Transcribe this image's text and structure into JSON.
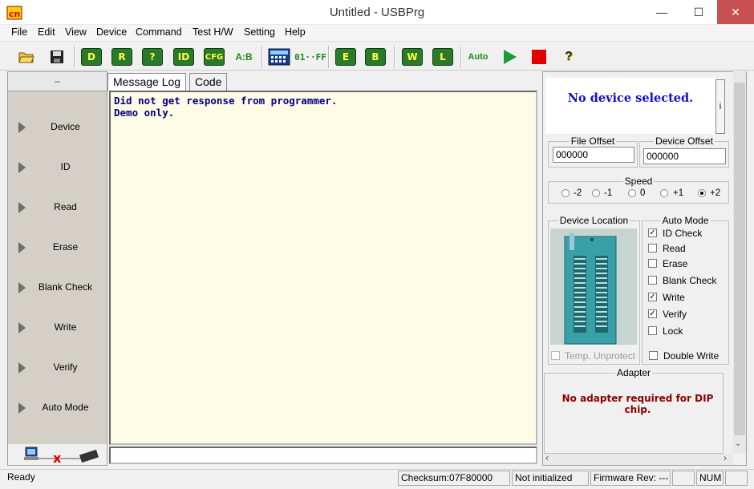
{
  "window": {
    "title": "Untitled - USBPrg",
    "minimize": "—",
    "maximize": "☐",
    "close": "✕"
  },
  "menu": [
    "File",
    "Edit",
    "View",
    "Device",
    "Command",
    "Test H/W",
    "Setting",
    "Help"
  ],
  "toolbar": {
    "device_label": "D",
    "read_label": "R",
    "verify_label": "?",
    "id_label": "ID",
    "cfg_label": "CFG",
    "compare_label": "A:B",
    "hex_label": "01··FF",
    "erase_label": "E",
    "blank_label": "B",
    "write_label": "W",
    "lock_label": "L",
    "auto_label": "Auto",
    "help_label": "?"
  },
  "left_panel": {
    "header": "–",
    "buttons": [
      "Device",
      "ID",
      "Read",
      "Erase",
      "Blank Check",
      "Write",
      "Verify",
      "Auto Mode"
    ]
  },
  "tabs": [
    "Message Log",
    "Code"
  ],
  "log": {
    "lines": [
      "Did not get response from programmer.",
      "Demo only."
    ]
  },
  "right_panel": {
    "device_message": "No device selected.",
    "info_button": "i",
    "file_offset": {
      "label": "File Offset",
      "value": "000000"
    },
    "device_offset": {
      "label": "Device Offset",
      "value": "000000"
    },
    "speed": {
      "label": "Speed",
      "options": [
        "-2",
        "-1",
        "0",
        "+1",
        "+2"
      ],
      "selected": "+2"
    },
    "device_location": {
      "label": "Device Location"
    },
    "temp_unprotect": "Temp. Unprotect",
    "auto_mode": {
      "label": "Auto Mode",
      "items": [
        {
          "label": "ID Check",
          "checked": true
        },
        {
          "label": "Read",
          "checked": false
        },
        {
          "label": "Erase",
          "checked": false
        },
        {
          "label": "Blank Check",
          "checked": false
        },
        {
          "label": "Write",
          "checked": true
        },
        {
          "label": "Verify",
          "checked": true
        },
        {
          "label": "Lock",
          "checked": false
        }
      ],
      "double_write": "Double Write"
    },
    "adapter": {
      "label": "Adapter",
      "message": "No adapter required for DIP chip."
    }
  },
  "status": {
    "ready": "Ready",
    "checksum": "Checksum:07F80000",
    "init": "Not initialized",
    "firmware": "Firmware Rev: ---",
    "num": "NUM"
  }
}
